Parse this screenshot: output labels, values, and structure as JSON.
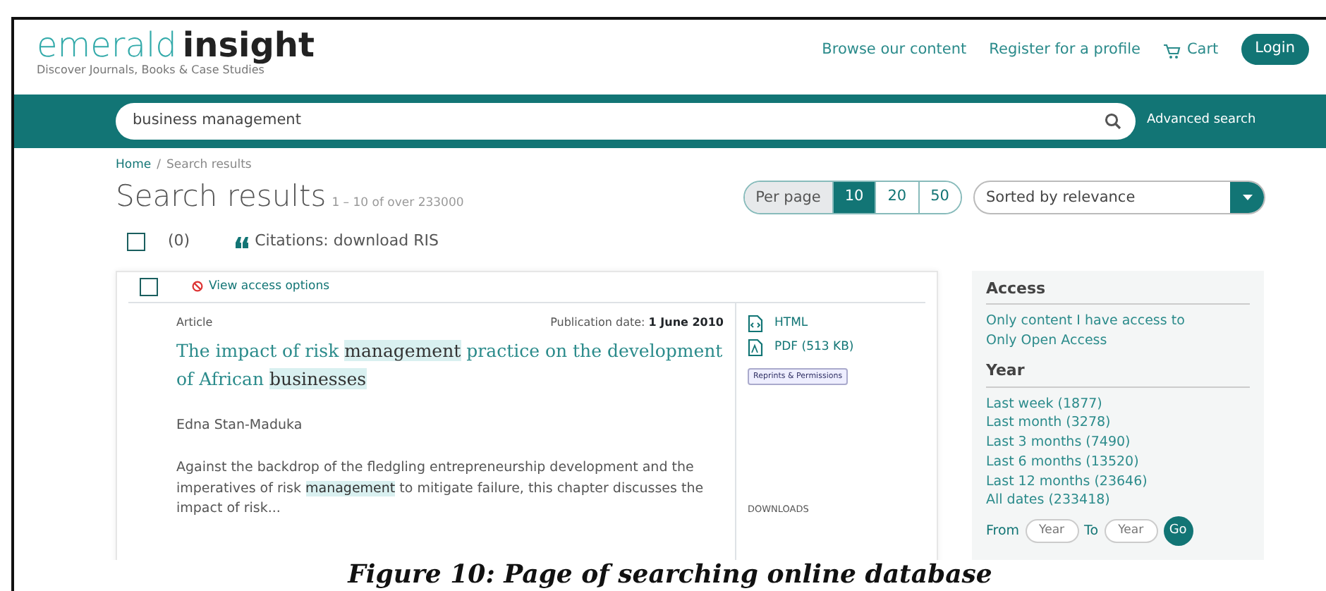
{
  "header": {
    "logo_light": "emerald",
    "logo_bold": "insight",
    "tagline": "Discover Journals, Books & Case Studies",
    "links": [
      {
        "label": "Browse our content",
        "kind": "text"
      },
      {
        "label": "Register for a profile",
        "kind": "text"
      },
      {
        "label": "Cart",
        "kind": "cart"
      }
    ],
    "login": "Login"
  },
  "search": {
    "value": "business management",
    "advanced": "Advanced search"
  },
  "breadcrumb": {
    "items": [
      "Home",
      "Search results"
    ],
    "separator": "/"
  },
  "results_header": {
    "title": "Search results",
    "range": "1 – 10 of over 233000",
    "per_page_label": "Per page",
    "per_page": [
      {
        "label": "10",
        "selected": true
      },
      {
        "label": "20",
        "selected": false
      },
      {
        "label": "50",
        "selected": false
      }
    ],
    "sort": "Sorted by relevance"
  },
  "selection": {
    "checked": false,
    "count": "(0)",
    "citations": "Citations: download RIS"
  },
  "result": {
    "checked": false,
    "access": "View access options",
    "type": "Article",
    "date_label": "Publication date:",
    "date": "1 June 2010",
    "title": [
      {
        "text": "The impact of risk ",
        "highlighted": false
      },
      {
        "text": "management",
        "highlighted": true
      },
      {
        "text": " practice on the development of African ",
        "highlighted": false
      },
      {
        "text": "businesses",
        "highlighted": true
      }
    ],
    "author": "Edna Stan-Maduka",
    "abstract": [
      {
        "text": "Against the backdrop of the fledgling entrepreneurship development and the imperatives of risk ",
        "highlighted": false
      },
      {
        "text": "management",
        "highlighted": true
      },
      {
        "text": " to mitigate failure, this chapter discusses the impact of risk...",
        "highlighted": false
      }
    ],
    "formats": [
      {
        "label": "HTML",
        "kind": "html"
      },
      {
        "label": "PDF (513 KB)",
        "kind": "pdf"
      }
    ],
    "reprints": "Reprints & Permissions",
    "downloads": "DOWNLOADS"
  },
  "filters": [
    {
      "heading": "Access",
      "items": [
        "Only content I have access to",
        "Only Open Access"
      ]
    },
    {
      "heading": "Year",
      "items": [
        "Last week (1877)",
        "Last month (3278)",
        "Last 3 months (7490)",
        "Last 6 months (13520)",
        "Last 12 months (23646)",
        "All dates (233418)"
      ]
    }
  ],
  "year_range": {
    "from": "From",
    "from_placeholder": "Year",
    "to": "To",
    "to_placeholder": "Year",
    "go": "Go"
  },
  "caption": "Figure 10: Page of searching online database"
}
